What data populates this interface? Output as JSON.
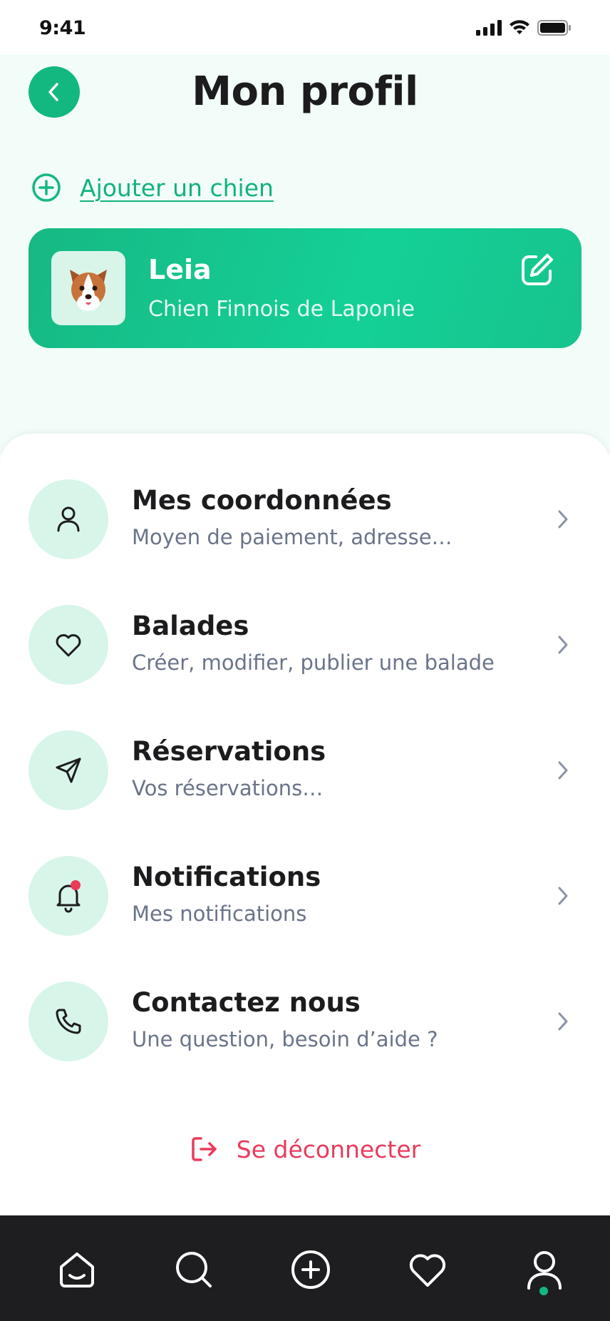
{
  "status_bar": {
    "time": "9:41"
  },
  "header": {
    "title": "Mon profil"
  },
  "add_dog": {
    "label": "Ajouter un chien"
  },
  "dog": {
    "name": "Leia",
    "breed": "Chien Finnois de Laponie"
  },
  "menu": [
    {
      "title": "Mes coordonnées",
      "subtitle": "Moyen de paiement, adresse…",
      "icon": "user-icon"
    },
    {
      "title": "Balades",
      "subtitle": "Créer, modifier, publier une balade",
      "icon": "heart-icon"
    },
    {
      "title": "Réservations",
      "subtitle": "Vos réservations…",
      "icon": "send-icon"
    },
    {
      "title": "Notifications",
      "subtitle": "Mes notifications",
      "icon": "bell-icon"
    },
    {
      "title": "Contactez nous",
      "subtitle": "Une question, besoin d’aide ?",
      "icon": "phone-icon"
    }
  ],
  "logout": {
    "label": "Se déconnecter"
  },
  "tab_bar": {
    "items": [
      "home-icon",
      "search-icon",
      "add-icon",
      "favorites-icon",
      "profile-icon"
    ],
    "active": "profile-icon"
  },
  "colors": {
    "accent": "#13b880",
    "card_gradient_end": "#14d097",
    "icon_bg": "#d8f5ea",
    "top_bg": "#f2fcf8",
    "danger": "#ea3b5b",
    "tab_bar_bg": "#1e1e20",
    "subtitle": "#6a7489",
    "notification_dot": "#ea3b5b"
  }
}
